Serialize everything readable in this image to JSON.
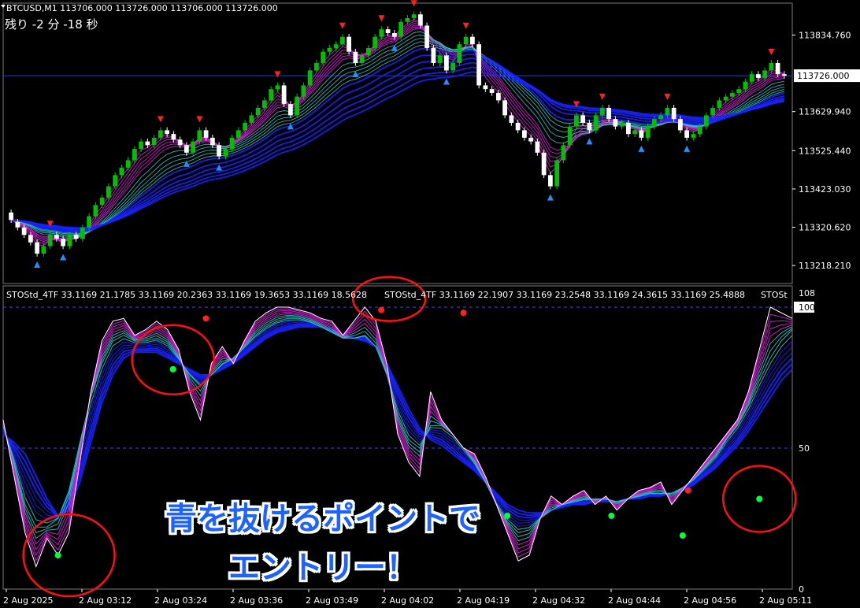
{
  "header": {
    "symbol_line": "BTCUSD,M1  113706.000 113726.000 113706.000 113726.000",
    "countdown": "残り -2 分 -18 秒"
  },
  "indicator": {
    "header_left": "STOStd_4TF 33.1169 21.1785 33.1169 20.2363 33.1169 19.3653 33.1169 18.5628",
    "header_mid": "STOStd_4TF 33.1169 22.1907 33.1169 23.2548 33.1169 24.3615 33.1169 25.4888",
    "header_right": "STOSt"
  },
  "annotation": {
    "line1": "青を抜けるポイントで",
    "line2": "エントリー！"
  },
  "colors": {
    "bull": "#00c000",
    "bear": "#ffffff",
    "blue_band": "#1a22ff",
    "cyan_band": "#2fc7c7",
    "magenta_band": "#e020e0",
    "sell_arrow": "#ff2020",
    "buy_arrow": "#1e90ff",
    "circle": "#ff1010",
    "dot_green": "#00ff3a",
    "dot_red": "#ff2020"
  },
  "chart_data": [
    {
      "type": "candlestick",
      "title": "BTCUSD,M1",
      "ylim": [
        113170,
        113920
      ],
      "y_ticks": [
        "113834.760",
        "113726.000",
        "113629.940",
        "113525.440",
        "113423.030",
        "113320.620",
        "113218.210"
      ],
      "x_ticks": [
        "2 Aug 2025",
        "2 Aug 03:12",
        "2 Aug 03:24",
        "2 Aug 03:36",
        "2 Aug 03:49",
        "2 Aug 04:02",
        "2 Aug 04:19",
        "2 Aug 04:32",
        "2 Aug 04:44",
        "2 Aug 04:56",
        "2 Aug 05:11"
      ],
      "last_price": "113726.000",
      "close": [
        113340,
        113320,
        113300,
        113280,
        113250,
        113270,
        113300,
        113290,
        113270,
        113300,
        113290,
        113320,
        113350,
        113380,
        113400,
        113430,
        113460,
        113480,
        113500,
        113530,
        113550,
        113540,
        113560,
        113580,
        113570,
        113555,
        113540,
        113520,
        113550,
        113580,
        113560,
        113540,
        113510,
        113530,
        113560,
        113580,
        113600,
        113620,
        113640,
        113660,
        113690,
        113700,
        113650,
        113620,
        113670,
        113700,
        113740,
        113760,
        113790,
        113800,
        113810,
        113830,
        113790,
        113760,
        113780,
        113800,
        113830,
        113850,
        113840,
        113830,
        113870,
        113880,
        113890,
        113860,
        113800,
        113760,
        113780,
        113740,
        113760,
        113810,
        113830,
        113810,
        113700,
        113690,
        113680,
        113660,
        113620,
        113600,
        113580,
        113560,
        113550,
        113520,
        113460,
        113430,
        113500,
        113540,
        113590,
        113620,
        113600,
        113580,
        113620,
        113640,
        113610,
        113590,
        113600,
        113570,
        113580,
        113560,
        113590,
        113610,
        113620,
        113640,
        113610,
        113580,
        113560,
        113570,
        113590,
        113620,
        113640,
        113660,
        113670,
        113680,
        113690,
        113710,
        113730,
        113720,
        113740,
        113760,
        113730,
        113726
      ],
      "open": [
        113360,
        113335,
        113320,
        113300,
        113280,
        113250,
        113270,
        113300,
        113290,
        113270,
        113300,
        113290,
        113320,
        113350,
        113380,
        113400,
        113430,
        113460,
        113480,
        113500,
        113530,
        113550,
        113540,
        113560,
        113580,
        113570,
        113555,
        113540,
        113520,
        113550,
        113580,
        113560,
        113540,
        113510,
        113530,
        113560,
        113580,
        113600,
        113620,
        113640,
        113660,
        113690,
        113700,
        113650,
        113620,
        113670,
        113700,
        113740,
        113760,
        113790,
        113800,
        113810,
        113830,
        113790,
        113760,
        113780,
        113800,
        113830,
        113850,
        113840,
        113830,
        113870,
        113880,
        113890,
        113860,
        113800,
        113760,
        113780,
        113740,
        113760,
        113810,
        113830,
        113810,
        113700,
        113690,
        113680,
        113660,
        113620,
        113600,
        113580,
        113560,
        113550,
        113520,
        113460,
        113430,
        113500,
        113540,
        113590,
        113620,
        113600,
        113580,
        113620,
        113640,
        113610,
        113590,
        113600,
        113570,
        113580,
        113560,
        113590,
        113610,
        113620,
        113640,
        113610,
        113580,
        113560,
        113570,
        113590,
        113620,
        113640,
        113660,
        113670,
        113680,
        113690,
        113710,
        113730,
        113720,
        113740,
        113760,
        113730
      ]
    },
    {
      "type": "line",
      "title": "STOStd_4TF",
      "ylim": [
        0,
        100
      ],
      "y_ticks": [
        "100",
        "50",
        "0"
      ],
      "y_label_top": "108",
      "levels": [
        100,
        50
      ],
      "series": [
        {
          "role": "fast",
          "values": [
            60,
            40,
            20,
            8,
            18,
            12,
            20,
            45,
            70,
            88,
            95,
            96,
            90,
            92,
            95,
            92,
            85,
            70,
            60,
            80,
            86,
            80,
            88,
            95,
            98,
            100,
            100,
            99,
            98,
            96,
            95,
            90,
            95,
            100,
            95,
            80,
            55,
            45,
            40,
            70,
            60,
            55,
            50,
            48,
            40,
            30,
            20,
            10,
            12,
            25,
            33,
            30,
            33,
            35,
            30,
            33,
            28,
            32,
            35,
            36,
            38,
            30,
            35,
            40,
            45,
            50,
            55,
            60,
            70,
            85,
            100,
            98,
            96
          ]
        },
        {
          "role": "band_mid",
          "values": [
            58,
            45,
            30,
            22,
            22,
            25,
            35,
            52,
            68,
            80,
            88,
            90,
            88,
            88,
            89,
            87,
            82,
            76,
            72,
            76,
            80,
            82,
            86,
            90,
            93,
            95,
            96,
            96,
            95,
            93,
            91,
            89,
            89,
            90,
            86,
            76,
            62,
            53,
            50,
            58,
            58,
            55,
            50,
            45,
            38,
            30,
            24,
            20,
            21,
            25,
            28,
            30,
            31,
            32,
            32,
            32,
            31,
            32,
            33,
            34,
            34,
            34,
            36,
            39,
            43,
            47,
            53,
            58,
            65,
            74,
            82,
            88,
            92
          ]
        },
        {
          "role": "blue_slow",
          "values": [
            55,
            52,
            48,
            40,
            32,
            26,
            28,
            38,
            52,
            66,
            76,
            82,
            84,
            84,
            84,
            82,
            80,
            78,
            76,
            76,
            78,
            80,
            83,
            86,
            89,
            91,
            92,
            93,
            93,
            93,
            92,
            90,
            89,
            88,
            86,
            80,
            72,
            64,
            57,
            53,
            51,
            48,
            45,
            42,
            38,
            34,
            30,
            28,
            27,
            27,
            28,
            29,
            30,
            30,
            31,
            31,
            31,
            32,
            32,
            33,
            33,
            34,
            35,
            37,
            40,
            43,
            47,
            51,
            56,
            62,
            68,
            74,
            78
          ]
        }
      ],
      "signals_green": [
        [
          10,
          12
        ],
        [
          31,
          78
        ],
        [
          92,
          26
        ],
        [
          111,
          26
        ],
        [
          124,
          19
        ],
        [
          138,
          32
        ]
      ],
      "signals_red": [
        [
          37,
          96
        ],
        [
          69,
          99
        ],
        [
          84,
          98
        ],
        [
          125,
          35
        ]
      ]
    }
  ]
}
